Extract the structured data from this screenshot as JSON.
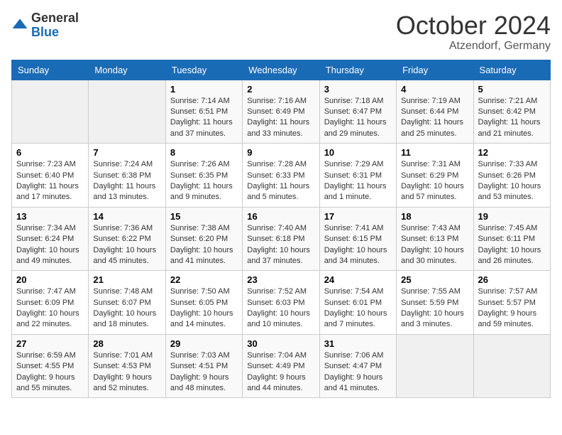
{
  "header": {
    "logo_general": "General",
    "logo_blue": "Blue",
    "month_title": "October 2024",
    "location": "Atzendorf, Germany"
  },
  "weekdays": [
    "Sunday",
    "Monday",
    "Tuesday",
    "Wednesday",
    "Thursday",
    "Friday",
    "Saturday"
  ],
  "weeks": [
    [
      {
        "day": "",
        "sunrise": "",
        "sunset": "",
        "daylight": ""
      },
      {
        "day": "",
        "sunrise": "",
        "sunset": "",
        "daylight": ""
      },
      {
        "day": "1",
        "sunrise": "Sunrise: 7:14 AM",
        "sunset": "Sunset: 6:51 PM",
        "daylight": "Daylight: 11 hours and 37 minutes."
      },
      {
        "day": "2",
        "sunrise": "Sunrise: 7:16 AM",
        "sunset": "Sunset: 6:49 PM",
        "daylight": "Daylight: 11 hours and 33 minutes."
      },
      {
        "day": "3",
        "sunrise": "Sunrise: 7:18 AM",
        "sunset": "Sunset: 6:47 PM",
        "daylight": "Daylight: 11 hours and 29 minutes."
      },
      {
        "day": "4",
        "sunrise": "Sunrise: 7:19 AM",
        "sunset": "Sunset: 6:44 PM",
        "daylight": "Daylight: 11 hours and 25 minutes."
      },
      {
        "day": "5",
        "sunrise": "Sunrise: 7:21 AM",
        "sunset": "Sunset: 6:42 PM",
        "daylight": "Daylight: 11 hours and 21 minutes."
      }
    ],
    [
      {
        "day": "6",
        "sunrise": "Sunrise: 7:23 AM",
        "sunset": "Sunset: 6:40 PM",
        "daylight": "Daylight: 11 hours and 17 minutes."
      },
      {
        "day": "7",
        "sunrise": "Sunrise: 7:24 AM",
        "sunset": "Sunset: 6:38 PM",
        "daylight": "Daylight: 11 hours and 13 minutes."
      },
      {
        "day": "8",
        "sunrise": "Sunrise: 7:26 AM",
        "sunset": "Sunset: 6:35 PM",
        "daylight": "Daylight: 11 hours and 9 minutes."
      },
      {
        "day": "9",
        "sunrise": "Sunrise: 7:28 AM",
        "sunset": "Sunset: 6:33 PM",
        "daylight": "Daylight: 11 hours and 5 minutes."
      },
      {
        "day": "10",
        "sunrise": "Sunrise: 7:29 AM",
        "sunset": "Sunset: 6:31 PM",
        "daylight": "Daylight: 11 hours and 1 minute."
      },
      {
        "day": "11",
        "sunrise": "Sunrise: 7:31 AM",
        "sunset": "Sunset: 6:29 PM",
        "daylight": "Daylight: 10 hours and 57 minutes."
      },
      {
        "day": "12",
        "sunrise": "Sunrise: 7:33 AM",
        "sunset": "Sunset: 6:26 PM",
        "daylight": "Daylight: 10 hours and 53 minutes."
      }
    ],
    [
      {
        "day": "13",
        "sunrise": "Sunrise: 7:34 AM",
        "sunset": "Sunset: 6:24 PM",
        "daylight": "Daylight: 10 hours and 49 minutes."
      },
      {
        "day": "14",
        "sunrise": "Sunrise: 7:36 AM",
        "sunset": "Sunset: 6:22 PM",
        "daylight": "Daylight: 10 hours and 45 minutes."
      },
      {
        "day": "15",
        "sunrise": "Sunrise: 7:38 AM",
        "sunset": "Sunset: 6:20 PM",
        "daylight": "Daylight: 10 hours and 41 minutes."
      },
      {
        "day": "16",
        "sunrise": "Sunrise: 7:40 AM",
        "sunset": "Sunset: 6:18 PM",
        "daylight": "Daylight: 10 hours and 37 minutes."
      },
      {
        "day": "17",
        "sunrise": "Sunrise: 7:41 AM",
        "sunset": "Sunset: 6:15 PM",
        "daylight": "Daylight: 10 hours and 34 minutes."
      },
      {
        "day": "18",
        "sunrise": "Sunrise: 7:43 AM",
        "sunset": "Sunset: 6:13 PM",
        "daylight": "Daylight: 10 hours and 30 minutes."
      },
      {
        "day": "19",
        "sunrise": "Sunrise: 7:45 AM",
        "sunset": "Sunset: 6:11 PM",
        "daylight": "Daylight: 10 hours and 26 minutes."
      }
    ],
    [
      {
        "day": "20",
        "sunrise": "Sunrise: 7:47 AM",
        "sunset": "Sunset: 6:09 PM",
        "daylight": "Daylight: 10 hours and 22 minutes."
      },
      {
        "day": "21",
        "sunrise": "Sunrise: 7:48 AM",
        "sunset": "Sunset: 6:07 PM",
        "daylight": "Daylight: 10 hours and 18 minutes."
      },
      {
        "day": "22",
        "sunrise": "Sunrise: 7:50 AM",
        "sunset": "Sunset: 6:05 PM",
        "daylight": "Daylight: 10 hours and 14 minutes."
      },
      {
        "day": "23",
        "sunrise": "Sunrise: 7:52 AM",
        "sunset": "Sunset: 6:03 PM",
        "daylight": "Daylight: 10 hours and 10 minutes."
      },
      {
        "day": "24",
        "sunrise": "Sunrise: 7:54 AM",
        "sunset": "Sunset: 6:01 PM",
        "daylight": "Daylight: 10 hours and 7 minutes."
      },
      {
        "day": "25",
        "sunrise": "Sunrise: 7:55 AM",
        "sunset": "Sunset: 5:59 PM",
        "daylight": "Daylight: 10 hours and 3 minutes."
      },
      {
        "day": "26",
        "sunrise": "Sunrise: 7:57 AM",
        "sunset": "Sunset: 5:57 PM",
        "daylight": "Daylight: 9 hours and 59 minutes."
      }
    ],
    [
      {
        "day": "27",
        "sunrise": "Sunrise: 6:59 AM",
        "sunset": "Sunset: 4:55 PM",
        "daylight": "Daylight: 9 hours and 55 minutes."
      },
      {
        "day": "28",
        "sunrise": "Sunrise: 7:01 AM",
        "sunset": "Sunset: 4:53 PM",
        "daylight": "Daylight: 9 hours and 52 minutes."
      },
      {
        "day": "29",
        "sunrise": "Sunrise: 7:03 AM",
        "sunset": "Sunset: 4:51 PM",
        "daylight": "Daylight: 9 hours and 48 minutes."
      },
      {
        "day": "30",
        "sunrise": "Sunrise: 7:04 AM",
        "sunset": "Sunset: 4:49 PM",
        "daylight": "Daylight: 9 hours and 44 minutes."
      },
      {
        "day": "31",
        "sunrise": "Sunrise: 7:06 AM",
        "sunset": "Sunset: 4:47 PM",
        "daylight": "Daylight: 9 hours and 41 minutes."
      },
      {
        "day": "",
        "sunrise": "",
        "sunset": "",
        "daylight": ""
      },
      {
        "day": "",
        "sunrise": "",
        "sunset": "",
        "daylight": ""
      }
    ]
  ]
}
